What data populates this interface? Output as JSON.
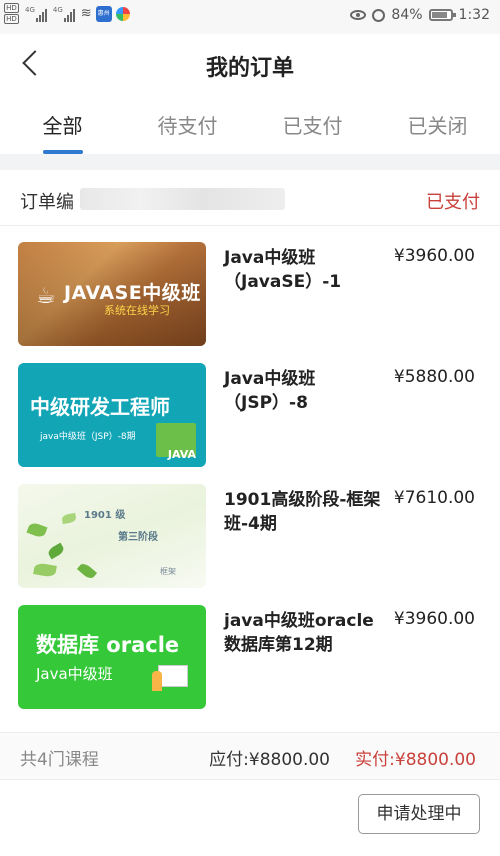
{
  "status_bar": {
    "battery": "84%",
    "time": "1:32",
    "sim1": "HD",
    "sim2": "HD",
    "net1": "4G",
    "net2": "4G",
    "app_label": "惠州"
  },
  "header": {
    "title": "我的订单"
  },
  "tabs": [
    {
      "label": "全部",
      "active": true
    },
    {
      "label": "待支付",
      "active": false
    },
    {
      "label": "已支付",
      "active": false
    },
    {
      "label": "已关闭",
      "active": false
    }
  ],
  "order": {
    "order_label": "订单编",
    "status": "已支付",
    "items": [
      {
        "name": "Java中级班（JavaSE）-1",
        "price": "¥3960.00",
        "thumb": {
          "title": "JAVASE中级班",
          "subtitle": "系统在线学习"
        }
      },
      {
        "name": "Java中级班（JSP）-8",
        "price": "¥5880.00",
        "thumb": {
          "title": "中级研发工程师",
          "subtitle": "java中级班（JSP）-8期",
          "badge": "JAVA"
        }
      },
      {
        "name": "1901高级阶段-框架班-4期",
        "price": "¥7610.00",
        "thumb": {
          "line1": "1901 级",
          "line2": "第三阶段",
          "line3": "框架"
        }
      },
      {
        "name": "java中级班oracle数据库第12期",
        "price": "¥3960.00",
        "thumb": {
          "title": "数据库 oracle",
          "subtitle": "Java中级班"
        }
      }
    ],
    "summary": {
      "count": "共4门课程",
      "payable": "应付:¥8800.00",
      "paid": "实付:¥8800.00"
    },
    "action_button": "申请处理中"
  }
}
